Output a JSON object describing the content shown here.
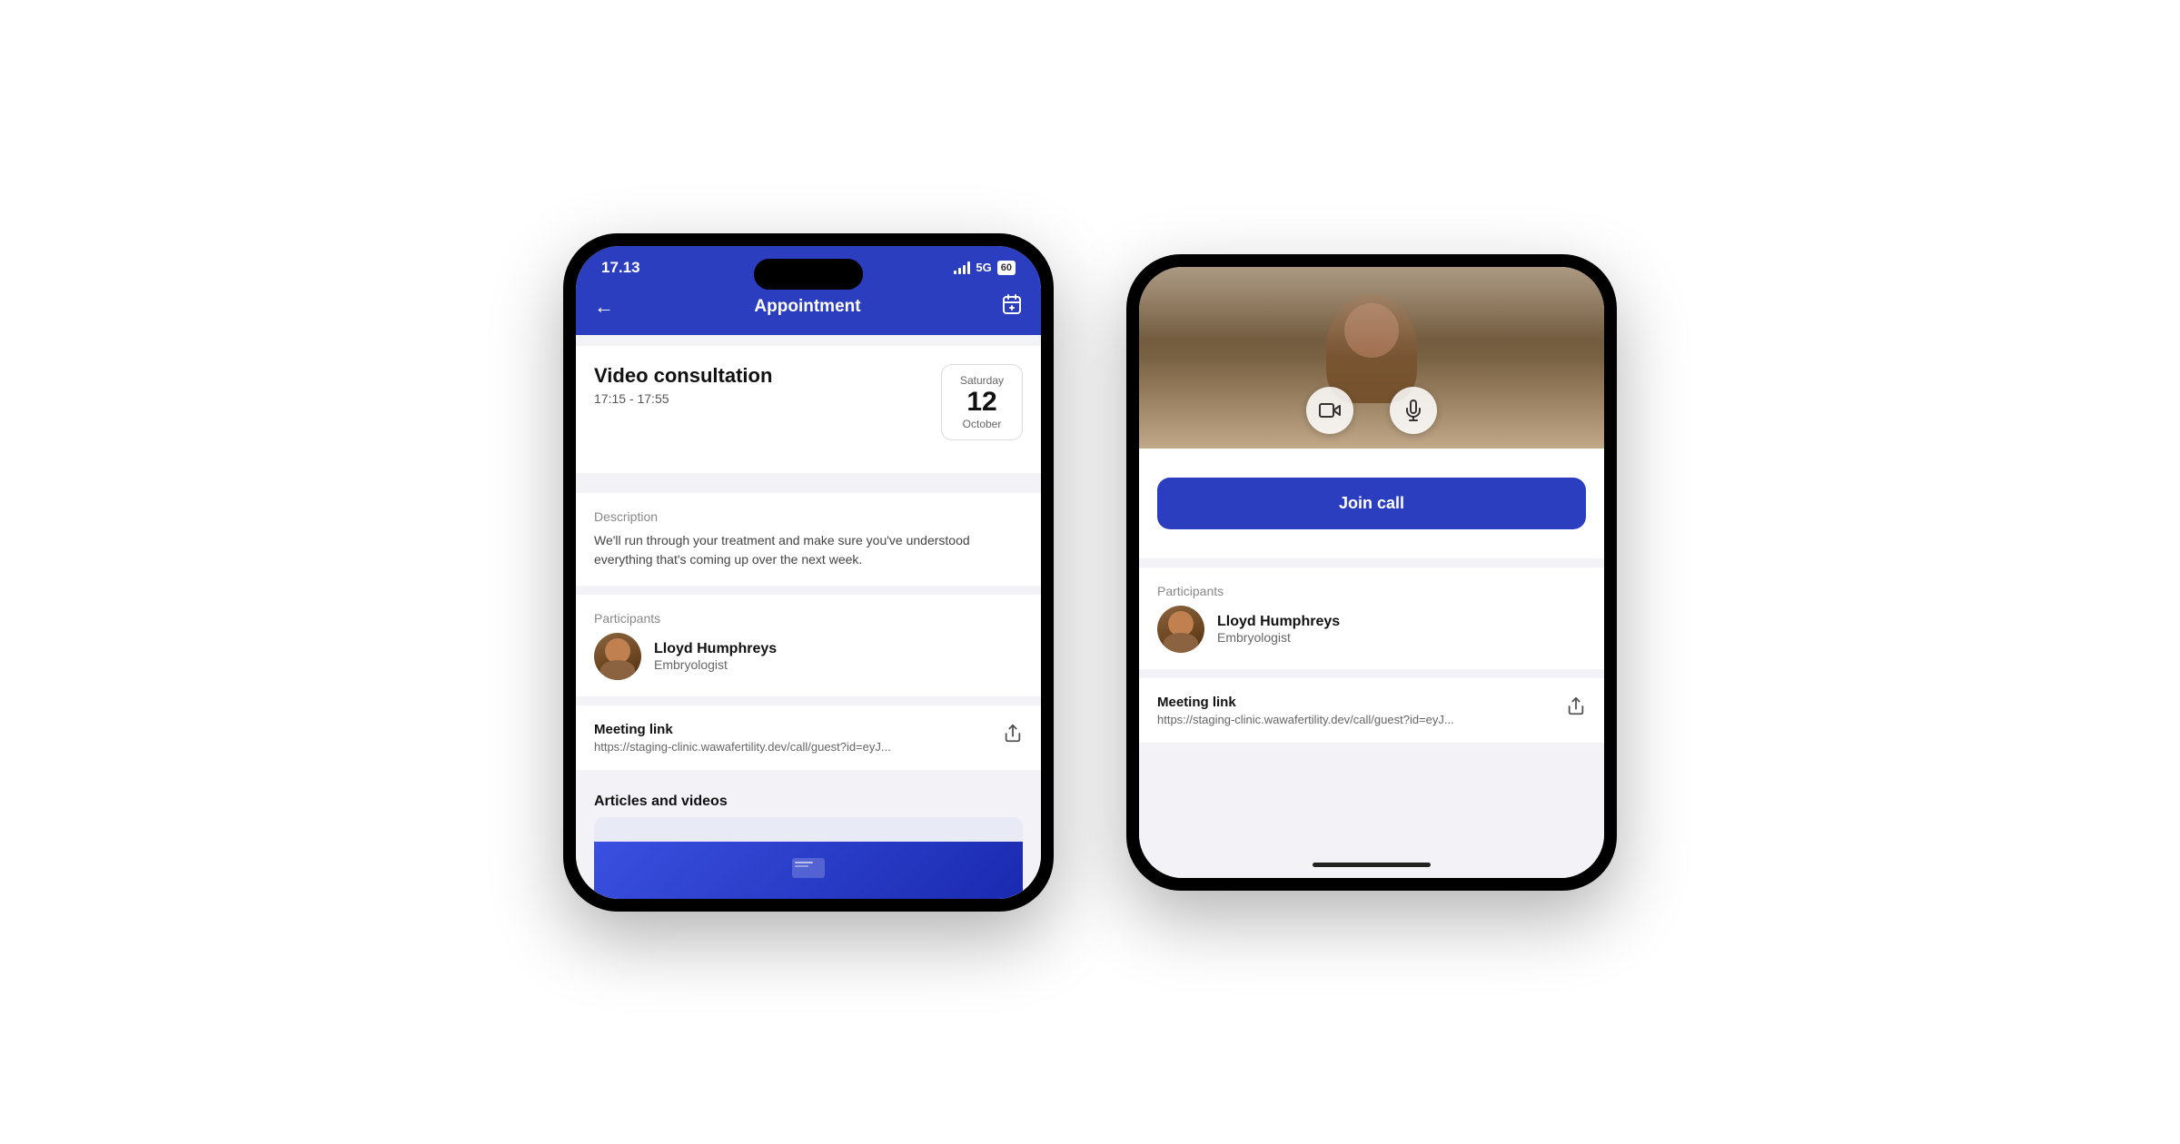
{
  "phone1": {
    "status": {
      "time": "17.13",
      "network": "5G",
      "battery": "60"
    },
    "nav": {
      "title": "Appointment",
      "back_label": "←",
      "calendar_icon": "📅"
    },
    "appointment": {
      "title": "Video consultation",
      "time_range": "17:15 - 17:55",
      "date": {
        "day_name": "Saturday",
        "day_num": "12",
        "month": "October"
      }
    },
    "description": {
      "label": "Description",
      "text": "We'll run through your treatment and make sure you've understood everything that's coming up over the next week."
    },
    "participants": {
      "label": "Participants",
      "person": {
        "name": "Lloyd Humphreys",
        "role": "Embryologist"
      }
    },
    "meeting_link": {
      "label": "Meeting link",
      "url": "https://staging-clinic.wawafertility.dev/call/guest?id=eyJ..."
    },
    "articles": {
      "label": "Articles and videos"
    }
  },
  "phone2": {
    "video_controls": {
      "camera_icon": "video",
      "mic_icon": "mic"
    },
    "join_call_btn": "Join call",
    "participants": {
      "label": "Participants",
      "person": {
        "name": "Lloyd Humphreys",
        "role": "Embryologist"
      }
    },
    "meeting_link": {
      "label": "Meeting link",
      "url": "https://staging-clinic.wawafertility.dev/call/guest?id=eyJ..."
    }
  }
}
